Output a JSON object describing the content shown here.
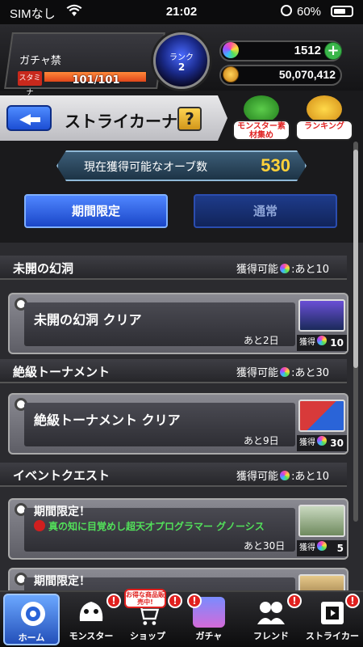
{
  "status_bar": {
    "carrier": "SIMなし",
    "time": "21:02",
    "battery": "60%"
  },
  "player": {
    "gacha_ban": "ガチャ禁",
    "stamina_label": "スタミナ",
    "stamina": "101/101",
    "stamina_fill": 1.0,
    "rank_label": "ランク",
    "rank": "2",
    "orbs": "1512",
    "gold": "50,070,412"
  },
  "titlebar": {
    "title": "ストライカーナビ",
    "help": "?"
  },
  "side_buttons": {
    "materials": "モンスター素材集め",
    "ranking": "ランキング"
  },
  "orb_banner": {
    "label": "現在獲得可能なオーブ数",
    "value": "530"
  },
  "tabs": [
    {
      "label": "期間限定",
      "active": true
    },
    {
      "label": "通常",
      "active": false
    }
  ],
  "sections": [
    {
      "name": "未開の幻洞",
      "avail_prefix": "獲得可能",
      "avail_suffix": ":あと10",
      "quest": {
        "title": "未開の幻洞 クリア",
        "remain": "あと2日",
        "reward_label": "獲得",
        "reward": "10"
      }
    },
    {
      "name": "絶級トーナメント",
      "avail_prefix": "獲得可能",
      "avail_suffix": ":あと30",
      "quest": {
        "title": "絶級トーナメント クリア",
        "remain": "あと9日",
        "reward_label": "獲得",
        "reward": "30"
      }
    },
    {
      "name": "イベントクエスト",
      "avail_prefix": "獲得可能",
      "avail_suffix": ":あと10",
      "quest": {
        "limited": "期間限定！",
        "event_line": "真の知に目覚めし超天才プログラマー グノーシス",
        "remain": "あと30日",
        "reward_label": "獲得",
        "reward": "5"
      },
      "next_limited": "期間限定！"
    }
  ],
  "bottom_nav": [
    {
      "label": "ホーム",
      "badge": ""
    },
    {
      "label": "モンスター",
      "badge": "!"
    },
    {
      "label": "ショップ",
      "badge": "!",
      "promo": "お得な商品販売中!"
    },
    {
      "label": "ガチャ",
      "badge": "!"
    },
    {
      "label": "フレンド",
      "badge": "!"
    },
    {
      "label": "ストライカー",
      "badge": "!"
    }
  ],
  "colors": {
    "accent_blue": "#1a46c8",
    "gold_text": "#ffd23a",
    "event_green": "#52e05a",
    "badge_red": "#e0201e"
  }
}
